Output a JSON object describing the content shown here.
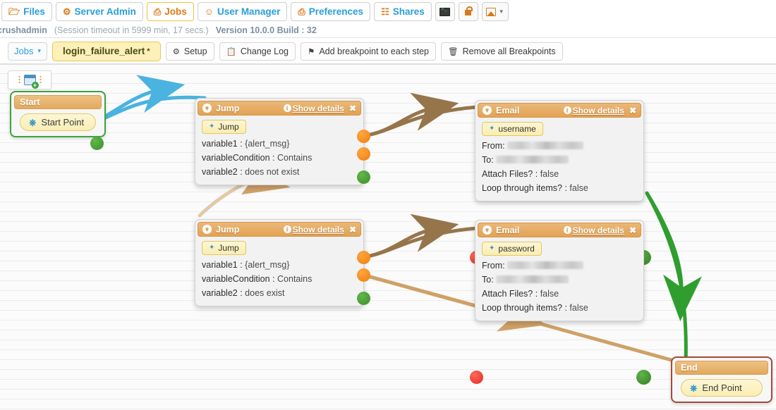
{
  "topnav": {
    "items": [
      {
        "label": "Files",
        "icon": "folder-icon",
        "active": false
      },
      {
        "label": "Server Admin",
        "icon": "gear-icon",
        "active": false
      },
      {
        "label": "Jobs",
        "icon": "jobs-icon",
        "active": true
      },
      {
        "label": "User Manager",
        "icon": "user-icon",
        "active": false
      },
      {
        "label": "Preferences",
        "icon": "preferences-icon",
        "active": false
      },
      {
        "label": "Shares",
        "icon": "shares-icon",
        "active": false
      }
    ],
    "icon_buttons": [
      {
        "name": "terminal-icon"
      },
      {
        "name": "lock-icon"
      },
      {
        "name": "image-dropdown-icon"
      }
    ]
  },
  "session": {
    "user": "crushadmin",
    "timeout": "(Session timeout in 5999 min, 17 secs.)",
    "version": "Version 10.0.0 Build : 32"
  },
  "jobbar": {
    "jobs_dropdown": "Jobs",
    "job_name": "login_failure_alert",
    "job_modified_marker": "*",
    "buttons": [
      {
        "label": "Setup",
        "icon": "gear-icon"
      },
      {
        "label": "Change Log",
        "icon": "clipboard-icon"
      },
      {
        "label": "Add breakpoint to each step",
        "icon": "flag-icon"
      },
      {
        "label": "Remove all Breakpoints",
        "icon": "trash-icon"
      }
    ]
  },
  "canvas": {
    "palette": {
      "add_step_icon": "add-step-icon"
    },
    "nodes": {
      "start": {
        "header": "Start",
        "body_label": "Start Point"
      },
      "end": {
        "header": "End",
        "body_label": "End Point"
      },
      "jump1": {
        "title": "Jump",
        "show_details": "Show details",
        "tag": "Jump",
        "rows": [
          {
            "key": "variable1 :",
            "value": "{alert_msg}"
          },
          {
            "key": "variableCondition :",
            "value": "Contains"
          },
          {
            "key": "variable2 :",
            "value": "does not exist"
          }
        ]
      },
      "jump2": {
        "title": "Jump",
        "show_details": "Show details",
        "tag": "Jump",
        "rows": [
          {
            "key": "variable1 :",
            "value": "{alert_msg}"
          },
          {
            "key": "variableCondition :",
            "value": "Contains"
          },
          {
            "key": "variable2 :",
            "value": "does exist"
          }
        ]
      },
      "email1": {
        "title": "Email",
        "show_details": "Show details",
        "tag": "username",
        "from_label": "From:",
        "from_value": "",
        "to_label": "To:",
        "to_value": "",
        "rows": [
          {
            "key": "Attach Files? :",
            "value": "false"
          },
          {
            "key": "Loop through items? :",
            "value": "false"
          }
        ]
      },
      "email2": {
        "title": "Email",
        "show_details": "Show details",
        "tag": "password",
        "from_label": "From:",
        "from_value": "",
        "to_label": "To:",
        "to_value": "",
        "rows": [
          {
            "key": "Attach Files? :",
            "value": "false"
          },
          {
            "key": "Loop through items? :",
            "value": "false"
          }
        ]
      }
    }
  },
  "colors": {
    "accent_orange": "#e07a12",
    "link_blue": "#2a9fd8",
    "node_header": "#e3a253",
    "port_orange": "#f07d0c",
    "port_green": "#3a8f2a",
    "port_red": "#e02a1c",
    "wire_blue": "#4ab3e0",
    "wire_brown": "#97754b",
    "wire_tan": "#d2a66d",
    "wire_green": "#2f9e2f",
    "start_border": "#3ea33e",
    "end_border": "#a6483c"
  }
}
